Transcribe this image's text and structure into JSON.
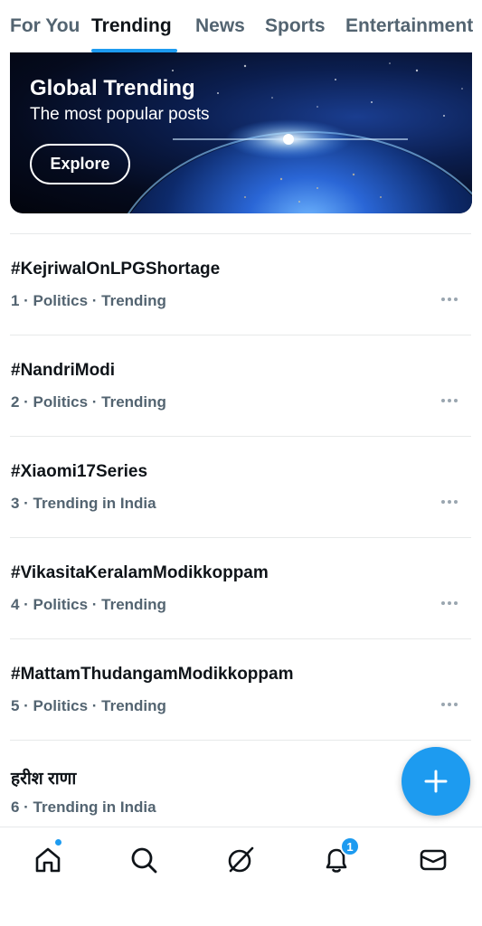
{
  "tabs": [
    "For You",
    "Trending",
    "News",
    "Sports",
    "Entertainment"
  ],
  "active_tab": "Trending",
  "banner": {
    "title": "Global Trending",
    "subtitle": "The most popular posts",
    "button_label": "Explore"
  },
  "trends": [
    {
      "title": "#KejriwalOnLPGShortage",
      "meta": "1 · Politics · Trending"
    },
    {
      "title": "#NandriModi",
      "meta": "2 · Politics · Trending"
    },
    {
      "title": "#Xiaomi17Series",
      "meta": "3 · Trending in India"
    },
    {
      "title": "#VikasitaKeralamModikkoppam",
      "meta": "4 · Politics · Trending"
    },
    {
      "title": "#MattamThudangamModikkoppam",
      "meta": "5 · Politics · Trending"
    },
    {
      "title": "हरीश राणा",
      "meta": "6 · Trending in India"
    }
  ],
  "bottom_nav": {
    "items": [
      "home-icon",
      "search-icon",
      "grok-icon",
      "notifications-icon",
      "messages-icon"
    ],
    "notification_count": "1"
  },
  "colors": {
    "accent": "#1d9bf0",
    "text": "#0f1419",
    "secondary": "#536471"
  }
}
